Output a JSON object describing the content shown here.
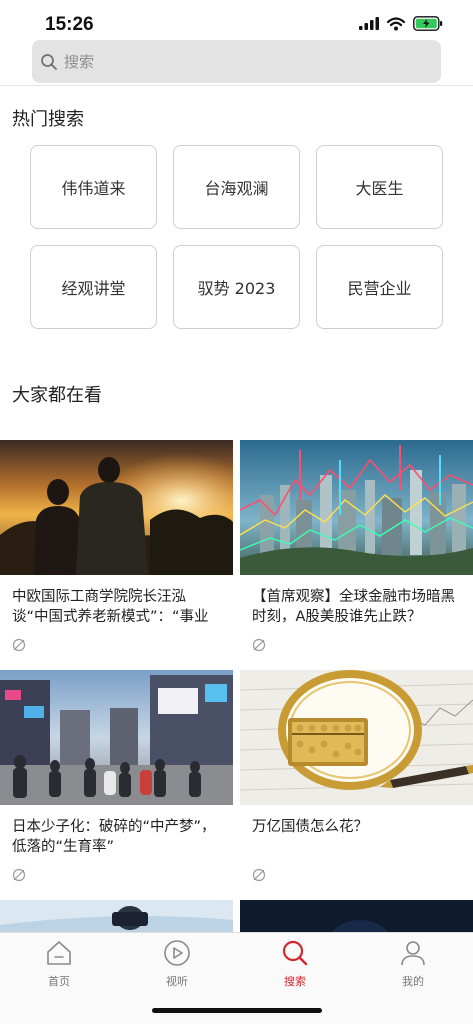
{
  "status": {
    "time": "15:26"
  },
  "search": {
    "placeholder": "搜索"
  },
  "hot_search": {
    "title": "热门搜索",
    "items": [
      "伟伟道来",
      "台海观澜",
      "大医生",
      "经观讲堂",
      "驭势 2023",
      "民营企业"
    ]
  },
  "everyone": {
    "title": "大家都在看",
    "cards": [
      {
        "title": "中欧国际工商学院院长汪泓谈“中国式养老新模式”：“事业"
      },
      {
        "title": "【首席观察】全球金融市场暗黑时刻，A股美股谁先止跌？"
      },
      {
        "title": "日本少子化：破碎的“中产梦”，低落的“生育率”"
      },
      {
        "title": "万亿国债怎么花？"
      }
    ]
  },
  "tabbar": {
    "items": [
      {
        "label": "首页",
        "icon": "home-icon"
      },
      {
        "label": "视听",
        "icon": "play-icon"
      },
      {
        "label": "搜索",
        "icon": "search-icon"
      },
      {
        "label": "我的",
        "icon": "user-icon"
      }
    ],
    "active_color": "#d3262f"
  }
}
